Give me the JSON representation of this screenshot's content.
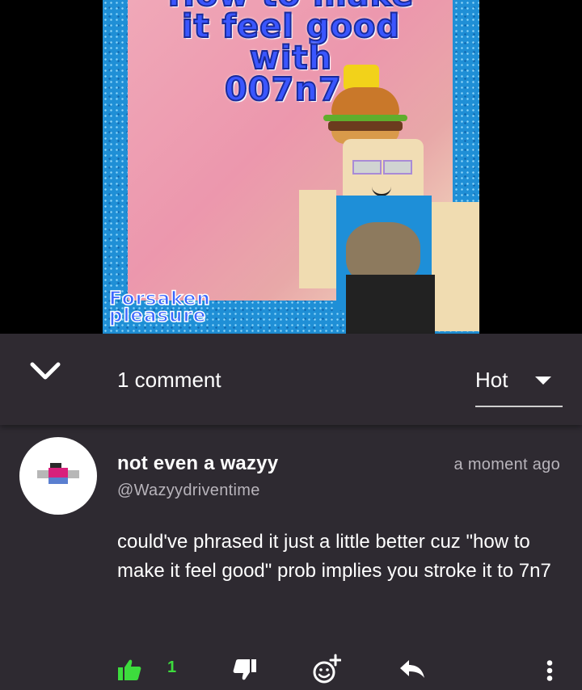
{
  "media": {
    "title_lines": [
      "How to make",
      "it feel good",
      "with",
      "007n7!"
    ],
    "watermark_lines": [
      "Forsaken",
      "pleasure"
    ]
  },
  "header": {
    "comment_count_label": "1 comment",
    "sort_value": "Hot"
  },
  "comment": {
    "author": "not even a wazyy",
    "handle": "@Wazyydriventime",
    "time": "a moment ago",
    "text": "could've phrased it just a little better cuz \"how to make it feel good\" prob implies you stroke it to 7n7",
    "likes": "1"
  },
  "colors": {
    "like_active": "#3ddc3d",
    "background": "#2e2a31",
    "text_muted": "#b8b4bb"
  },
  "icons": [
    "chevron-down-icon",
    "sort-caret-icon",
    "thumbs-up-icon",
    "thumbs-down-icon",
    "add-reaction-icon",
    "reply-icon",
    "more-vertical-icon"
  ]
}
